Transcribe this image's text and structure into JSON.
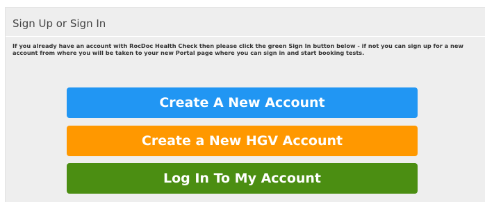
{
  "panel": {
    "title": "Sign Up or Sign In",
    "intro": "If you already have an account with RocDoc Health Check then please click the green Sign In button below - if not you can sign up for a new account from where you will be taken to your new Portal page where you can sign in and start booking tests."
  },
  "buttons": {
    "create_account": "Create A New Account",
    "create_hgv_account": "Create a New HGV Account",
    "log_in": "Log In To My Account"
  },
  "colors": {
    "create_account": "#2196f3",
    "create_hgv_account": "#ff9800",
    "log_in": "#4b8e12",
    "panel_background": "#eeeeee"
  }
}
